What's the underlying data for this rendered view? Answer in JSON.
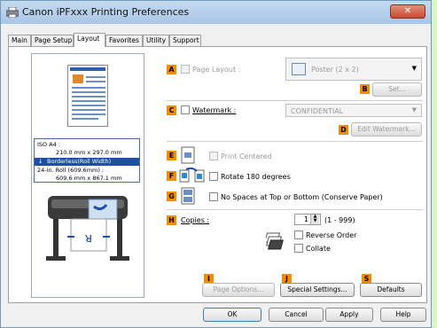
{
  "window": {
    "title": "Canon iPFxxx Printing Preferences",
    "close_glyph": "✕"
  },
  "tabs": [
    "Main",
    "Page Setup",
    "Layout",
    "Favorites",
    "Utility",
    "Support"
  ],
  "active_tab": "Layout",
  "preview": {
    "size_line1": "ISO A4 :",
    "size_line2": "210.0 mm x 297.0 mm",
    "mode": "Borderless(Roll Width)",
    "roll_line1": "24-in. Roll (609.6mm) :",
    "roll_line2": "609.6 mm x 867.1 mm"
  },
  "badges": {
    "a": "A",
    "b": "B",
    "c": "C",
    "d": "D",
    "e": "E",
    "f": "F",
    "g": "G",
    "h": "H",
    "i": "I",
    "j": "J",
    "s": "S"
  },
  "layout": {
    "page_layout_label": "Page Layout :",
    "page_layout_value": "Poster (2 x 2)",
    "set_button": "Set...",
    "watermark_label": "Watermark :",
    "watermark_value": "CONFIDENTIAL",
    "edit_watermark_button": "Edit Watermark...",
    "print_centered": "Print Centered",
    "rotate": "Rotate 180 degrees",
    "no_spaces": "No Spaces at Top or Bottom (Conserve Paper)",
    "copies_label": "Copies :",
    "copies_value": "1",
    "copies_range": "(1 - 999)",
    "reverse_order": "Reverse Order",
    "collate": "Collate",
    "page_options_button": "Page Options...",
    "special_settings_button": "Special Settings...",
    "defaults_button": "Defaults"
  },
  "footer": {
    "ok": "OK",
    "cancel": "Cancel",
    "apply": "Apply",
    "help": "Help"
  },
  "colors": {
    "badge": "#f28c00",
    "accent_blue": "#1f4fa5"
  }
}
